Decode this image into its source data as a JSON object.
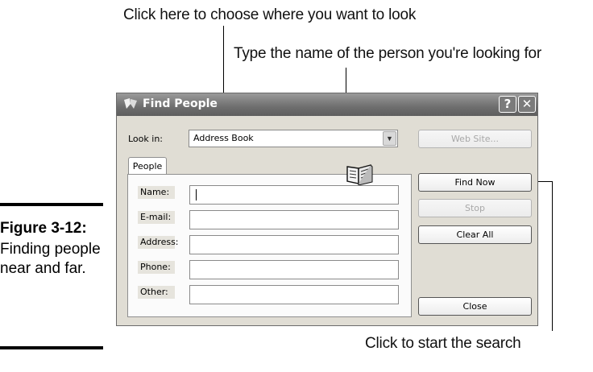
{
  "annotations": {
    "choose_where": "Click here to choose where you want to look",
    "type_name": "Type the name of the person you're looking for",
    "start_search": "Click to start the search"
  },
  "figure": {
    "number": "Figure 3-12:",
    "caption": "Finding people near and far."
  },
  "dialog": {
    "title": "Find People",
    "help_button": "?",
    "close_button": "✕",
    "look_in_label": "Look in:",
    "look_in_value": "Address Book",
    "web_site_button": "Web Site...",
    "tab_people": "People",
    "fields": [
      {
        "label": "Name:",
        "value": ""
      },
      {
        "label": "E-mail:",
        "value": ""
      },
      {
        "label": "Address:",
        "value": ""
      },
      {
        "label": "Phone:",
        "value": ""
      },
      {
        "label": "Other:",
        "value": ""
      }
    ],
    "find_now_button": "Find Now",
    "stop_button": "Stop",
    "clear_all_button": "Clear All",
    "close_button_label": "Close"
  },
  "icons": {
    "title_icon": "people-icon",
    "dropdown_icon": "chevron-down-icon",
    "address_book_icon": "open-book-icon"
  }
}
